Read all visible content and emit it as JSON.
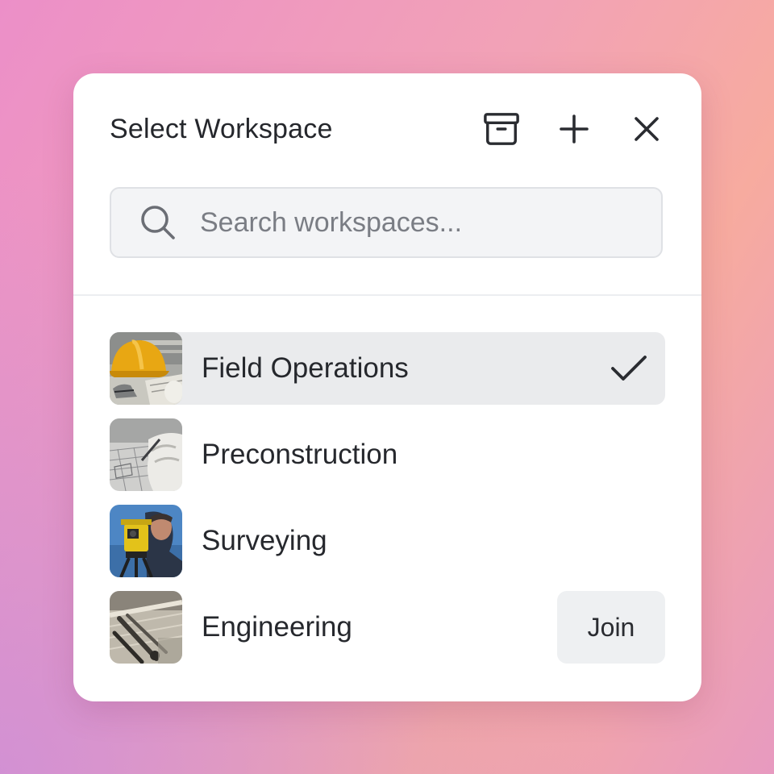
{
  "dialog": {
    "title": "Select Workspace",
    "actions": [
      {
        "name": "archive",
        "icon": "archive-icon"
      },
      {
        "name": "add",
        "icon": "plus-icon"
      },
      {
        "name": "close",
        "icon": "close-icon"
      }
    ]
  },
  "search": {
    "placeholder": "Search workspaces...",
    "value": "",
    "icon": "search-icon"
  },
  "workspaces": [
    {
      "label": "Field Operations",
      "thumbnail": "hard-hat-image",
      "selected": true,
      "indicator": "check-icon"
    },
    {
      "label": "Preconstruction",
      "thumbnail": "blueprint-drafting-image",
      "selected": false
    },
    {
      "label": "Surveying",
      "thumbnail": "surveyor-theodolite-image",
      "selected": false
    },
    {
      "label": "Engineering",
      "thumbnail": "engineering-tools-image",
      "selected": false,
      "action_label": "Join"
    }
  ],
  "colors": {
    "panel": "#ffffff",
    "selected_row": "#eaebed",
    "search_bg": "#f3f4f6",
    "text": "#25272c",
    "placeholder": "#7a7d84"
  }
}
